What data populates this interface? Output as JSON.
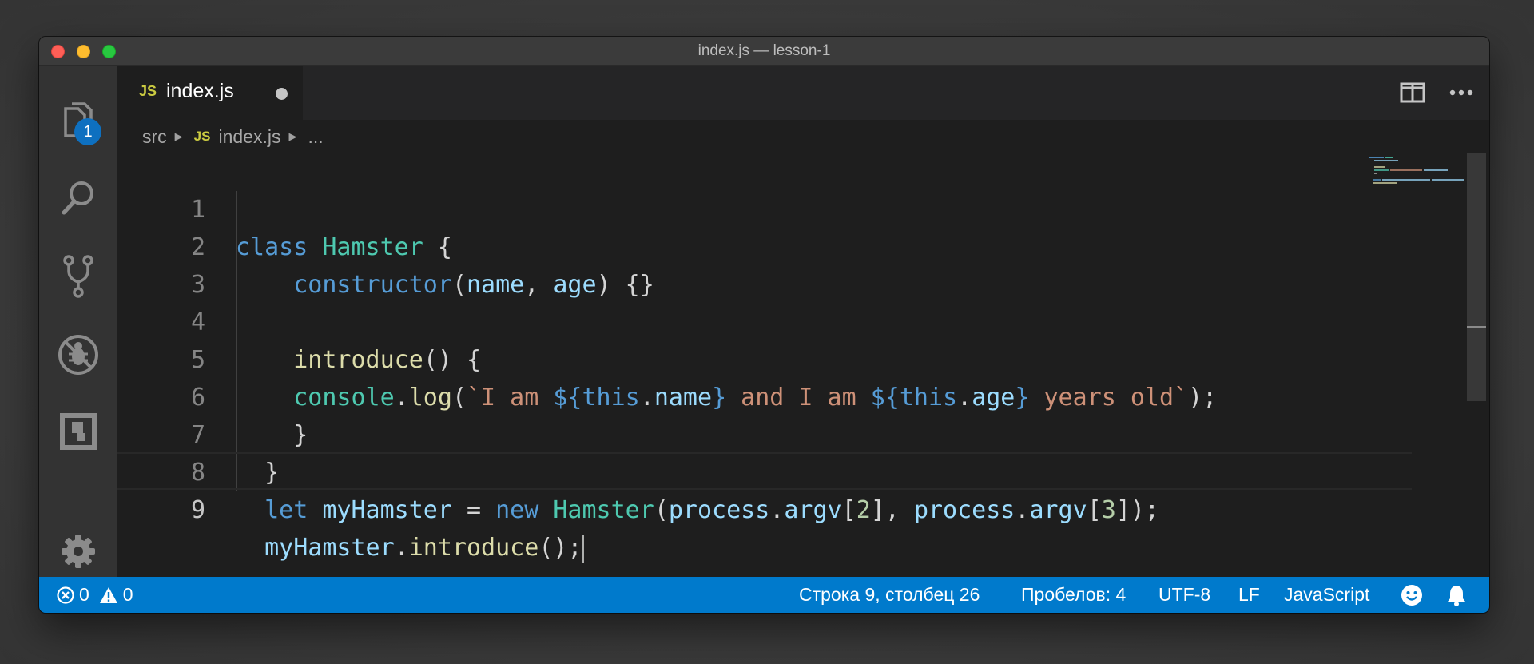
{
  "window": {
    "title": "index.js — lesson-1"
  },
  "activity_bar": {
    "items": [
      {
        "name": "explorer",
        "icon": "files-icon",
        "badge": "1"
      },
      {
        "name": "search",
        "icon": "search-icon"
      },
      {
        "name": "source-control",
        "icon": "source-control-icon"
      },
      {
        "name": "debug",
        "icon": "debug-icon"
      },
      {
        "name": "extensions",
        "icon": "extensions-icon"
      }
    ],
    "bottom": {
      "name": "manage",
      "icon": "gear-icon"
    }
  },
  "tabs": [
    {
      "lang_badge": "JS",
      "label": "index.js",
      "dirty": true
    }
  ],
  "breadcrumb": {
    "folder": "src",
    "lang_badge": "JS",
    "file": "index.js",
    "more": "..."
  },
  "editor": {
    "line_numbers": [
      "1",
      "2",
      "3",
      "4",
      "5",
      "6",
      "7",
      "8",
      "9"
    ],
    "current_line": "9",
    "lines": [
      "class Hamster {",
      "    constructor(name, age) {}",
      "",
      "    introduce() {",
      "    console.log(`I am ${this.name} and I am ${this.age} years old`);",
      "    }",
      "  }",
      "  let myHamster = new Hamster(process.argv[2], process.argv[3]);",
      "  myHamster.introduce();"
    ]
  },
  "status_bar": {
    "errors": "0",
    "warnings": "0",
    "position": "Строка 9, столбец 26",
    "indent": "Пробелов: 4",
    "encoding": "UTF-8",
    "eol": "LF",
    "language": "JavaScript"
  },
  "colors": {
    "accent": "#007acc",
    "keyword": "#569cd6",
    "class": "#4ec9b0",
    "function": "#dcdcaa",
    "variable": "#9cdcfe",
    "string": "#ce9178",
    "number": "#b5cea8",
    "js_badge": "#cbcb41"
  }
}
